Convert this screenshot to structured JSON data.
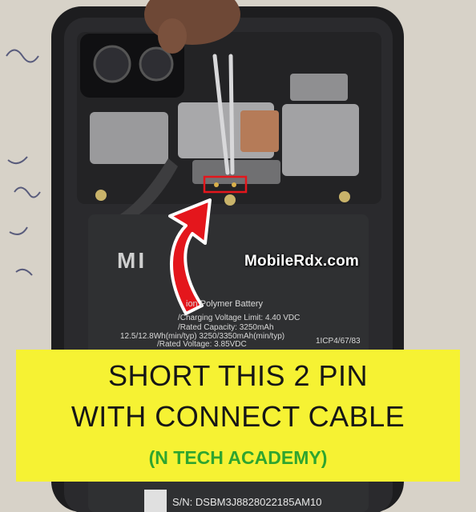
{
  "image": {
    "watermark": "MobileRdx.com",
    "caption": {
      "line1": "SHORT THIS 2 PIN",
      "line2": "WITH CONNECT CABLE",
      "credit": "(N TECH ACADEMY)"
    },
    "battery": {
      "brand": "MI",
      "line_type": "ion Polymer Battery",
      "line_voltage_limit": "/Charging Voltage Limit: 4.40 VDC",
      "line_capacity": "/Rated Capacity: 3250mAh",
      "line_energy": "12.5/12.8Wh(min/typ)    3250/3350mAh(min/typ)",
      "line_rated_voltage": "/Rated Voltage: 3.85VDC",
      "line_model_code": "1ICP4/67/83",
      "serial": "S/N: DSBM3J8828022185AM10"
    },
    "colors": {
      "caption_bg": "#f6f233",
      "caption_text": "#161616",
      "credit_text": "#2fa52f",
      "arrow": "#e4161c",
      "highlight_box": "#e4161c",
      "phone_body": "#1d1d1f"
    }
  }
}
